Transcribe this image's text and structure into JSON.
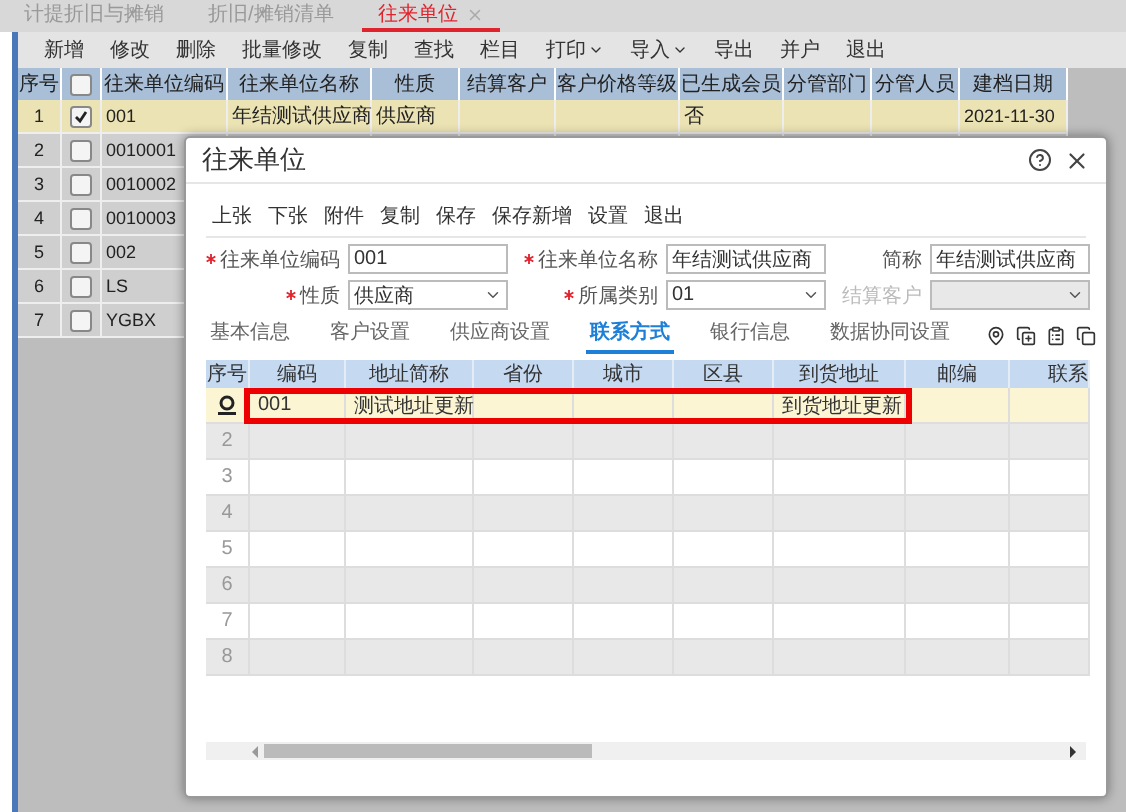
{
  "tabs": [
    {
      "label": "计提折旧与摊销",
      "selected": false,
      "closable": false
    },
    {
      "label": "折旧/摊销清单",
      "selected": false,
      "closable": false
    },
    {
      "label": "往来单位",
      "selected": true,
      "closable": true
    }
  ],
  "toolbar": [
    {
      "label": "新增",
      "dropdown": false
    },
    {
      "label": "修改",
      "dropdown": false
    },
    {
      "label": "删除",
      "dropdown": false
    },
    {
      "label": "批量修改",
      "dropdown": false
    },
    {
      "label": "复制",
      "dropdown": false
    },
    {
      "label": "查找",
      "dropdown": false
    },
    {
      "label": "栏目",
      "dropdown": false
    },
    {
      "label": "打印",
      "dropdown": true
    },
    {
      "label": "导入",
      "dropdown": true
    },
    {
      "label": "导出",
      "dropdown": false
    },
    {
      "label": "并户",
      "dropdown": false
    },
    {
      "label": "退出",
      "dropdown": false
    }
  ],
  "table": {
    "number_header": "序号",
    "header_checked": false,
    "columns": [
      "往来单位编码",
      "往来单位名称",
      "性质",
      "结算客户",
      "客户价格等级",
      "已生成会员",
      "分管部门",
      "分管人员",
      "建档日期"
    ],
    "rows": [
      {
        "no": "1",
        "checked": true,
        "selected": true,
        "cells": [
          "001",
          "年结测试供应商",
          "供应商",
          "",
          "",
          "否",
          "",
          "",
          "2021-11-30"
        ]
      },
      {
        "no": "2",
        "checked": false,
        "selected": false,
        "cells": [
          "0010001"
        ]
      },
      {
        "no": "3",
        "checked": false,
        "selected": false,
        "cells": [
          "0010002"
        ]
      },
      {
        "no": "4",
        "checked": false,
        "selected": false,
        "cells": [
          "0010003"
        ]
      },
      {
        "no": "5",
        "checked": false,
        "selected": false,
        "cells": [
          "002"
        ]
      },
      {
        "no": "6",
        "checked": false,
        "selected": false,
        "cells": [
          "LS"
        ]
      },
      {
        "no": "7",
        "checked": false,
        "selected": false,
        "cells": [
          "YGBX"
        ]
      }
    ]
  },
  "dialog": {
    "title": "往来单位",
    "toolbar": [
      "上张",
      "下张",
      "附件",
      "复制",
      "保存",
      "保存新增",
      "设置",
      "退出"
    ],
    "fields": [
      {
        "label": "往来单位编码",
        "required": true,
        "kind": "text",
        "value": "001",
        "disabled": false
      },
      {
        "label": "往来单位名称",
        "required": true,
        "kind": "text",
        "value": "年结测试供应商",
        "disabled": false
      },
      {
        "label": "简称",
        "required": false,
        "kind": "text",
        "value": "年结测试供应商",
        "disabled": false
      },
      {
        "label": "性质",
        "required": true,
        "kind": "select",
        "value": "供应商",
        "disabled": false
      },
      {
        "label": "所属类别",
        "required": true,
        "kind": "select",
        "value": "01",
        "disabled": false
      },
      {
        "label": "结算客户",
        "required": false,
        "kind": "select",
        "disabled": true
      }
    ],
    "tabs": [
      {
        "label": "基本信息",
        "selected": false
      },
      {
        "label": "客户设置",
        "selected": false
      },
      {
        "label": "供应商设置",
        "selected": false
      },
      {
        "label": "联系方式",
        "selected": true
      },
      {
        "label": "银行信息",
        "selected": false
      },
      {
        "label": "数据协同设置",
        "selected": false
      }
    ],
    "grid": {
      "number_header": "序号",
      "columns": [
        "编码",
        "地址简称",
        "省份",
        "城市",
        "区县",
        "到货地址",
        "邮编",
        "联系"
      ],
      "rows": [
        {
          "no": "",
          "editing": true,
          "highlighted": true,
          "cells": [
            "001",
            "测试地址更新",
            "",
            "",
            "",
            "到货地址更新",
            "",
            ""
          ]
        },
        {
          "no": "2",
          "editing": false,
          "highlighted": false,
          "cells": []
        },
        {
          "no": "3",
          "editing": false,
          "highlighted": false,
          "cells": []
        },
        {
          "no": "4",
          "editing": false,
          "highlighted": false,
          "cells": []
        },
        {
          "no": "5",
          "editing": false,
          "highlighted": false,
          "cells": []
        },
        {
          "no": "6",
          "editing": false,
          "highlighted": false,
          "cells": []
        },
        {
          "no": "7",
          "editing": false,
          "highlighted": false,
          "cells": []
        },
        {
          "no": "8",
          "editing": false,
          "highlighted": false,
          "cells": []
        }
      ]
    }
  }
}
